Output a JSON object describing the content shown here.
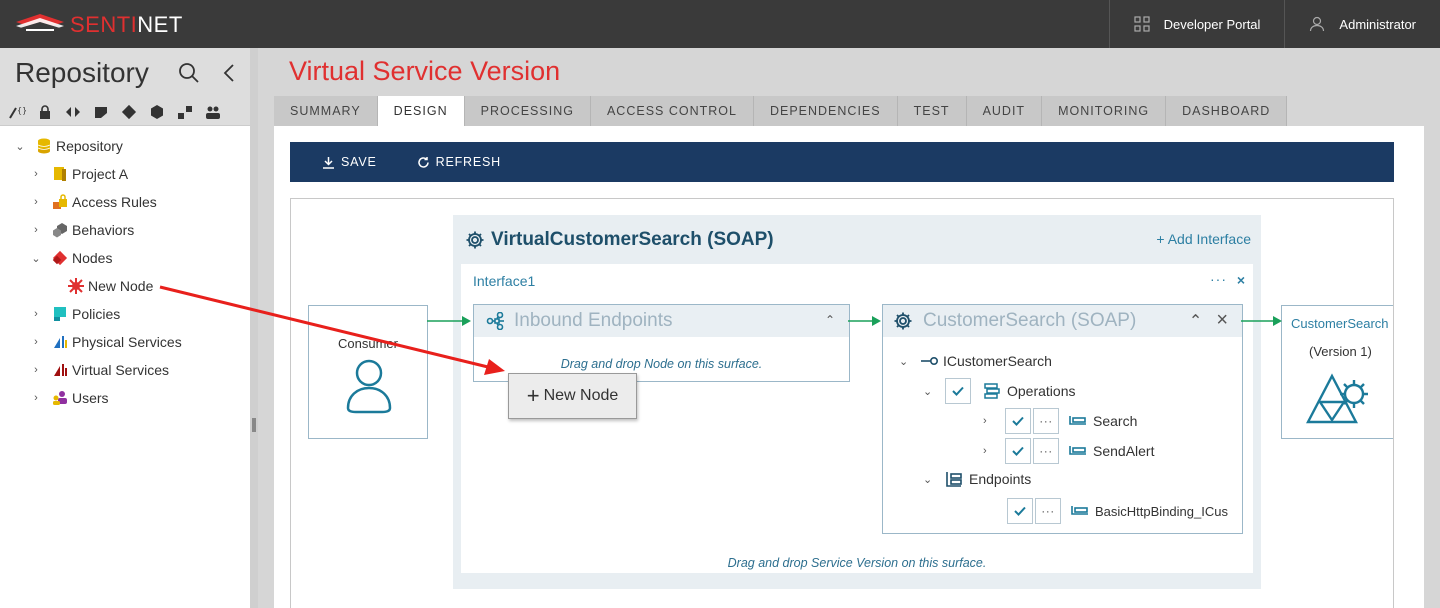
{
  "app": {
    "logo_text_1": "SENTI",
    "logo_text_2": "NET",
    "developer_portal": "Developer Portal",
    "user": "Administrator"
  },
  "sidebar": {
    "title": "Repository",
    "tree": [
      {
        "label": "Repository",
        "icon": "database-icon",
        "color": "#e6b800"
      },
      {
        "label": "Project A",
        "icon": "folder-icon",
        "color": "#d9a400"
      },
      {
        "label": "Access Rules",
        "icon": "lock-icon",
        "color": "#e07020"
      },
      {
        "label": "Behaviors",
        "icon": "behaviors-icon",
        "color": "#666666"
      },
      {
        "label": "Nodes",
        "icon": "node-icon",
        "color": "#e03030"
      },
      {
        "label": "New Node",
        "icon": "new-node-icon",
        "color": "#e03030"
      },
      {
        "label": "Policies",
        "icon": "policies-icon",
        "color": "#20c0c0"
      },
      {
        "label": "Physical Services",
        "icon": "physical-services-icon",
        "color": "#2070c0"
      },
      {
        "label": "Virtual Services",
        "icon": "virtual-services-icon",
        "color": "#a01010"
      },
      {
        "label": "Users",
        "icon": "users-icon",
        "color": "#9030a0"
      }
    ]
  },
  "main": {
    "title": "Virtual Service Version",
    "tabs": [
      "SUMMARY",
      "DESIGN",
      "PROCESSING",
      "ACCESS CONTROL",
      "DEPENDENCIES",
      "TEST",
      "AUDIT",
      "MONITORING",
      "DASHBOARD"
    ],
    "active_tab": "DESIGN",
    "toolbar": {
      "save": "SAVE",
      "refresh": "REFRESH"
    }
  },
  "canvas": {
    "consumer": "Consumer",
    "virtual_service": "VirtualCustomerSearch (SOAP)",
    "add_interface": "+ Add Interface",
    "interface_name": "Interface1",
    "interface_more": "···",
    "interface_close": "×",
    "inbound_title": "Inbound Endpoints",
    "inbound_hint": "Drag and drop Node on this surface.",
    "service_title": "CustomerSearch (SOAP)",
    "service_tree": {
      "interface": "ICustomerSearch",
      "operations": "Operations",
      "op_search": "Search",
      "op_sendalert": "SendAlert",
      "endpoints": "Endpoints",
      "endpoint": "BasicHttpBinding_ICus"
    },
    "drop_hint": "Drag and drop Service Version on this surface.",
    "target_name": "CustomerSearch",
    "target_version": "(Version 1)",
    "new_node_button": "New Node",
    "more_label": "···"
  },
  "colors": {
    "accent_red": "#e03030",
    "navy": "#1b3a63",
    "teal": "#2d7fa3",
    "green_arrow": "#1aa05a"
  }
}
